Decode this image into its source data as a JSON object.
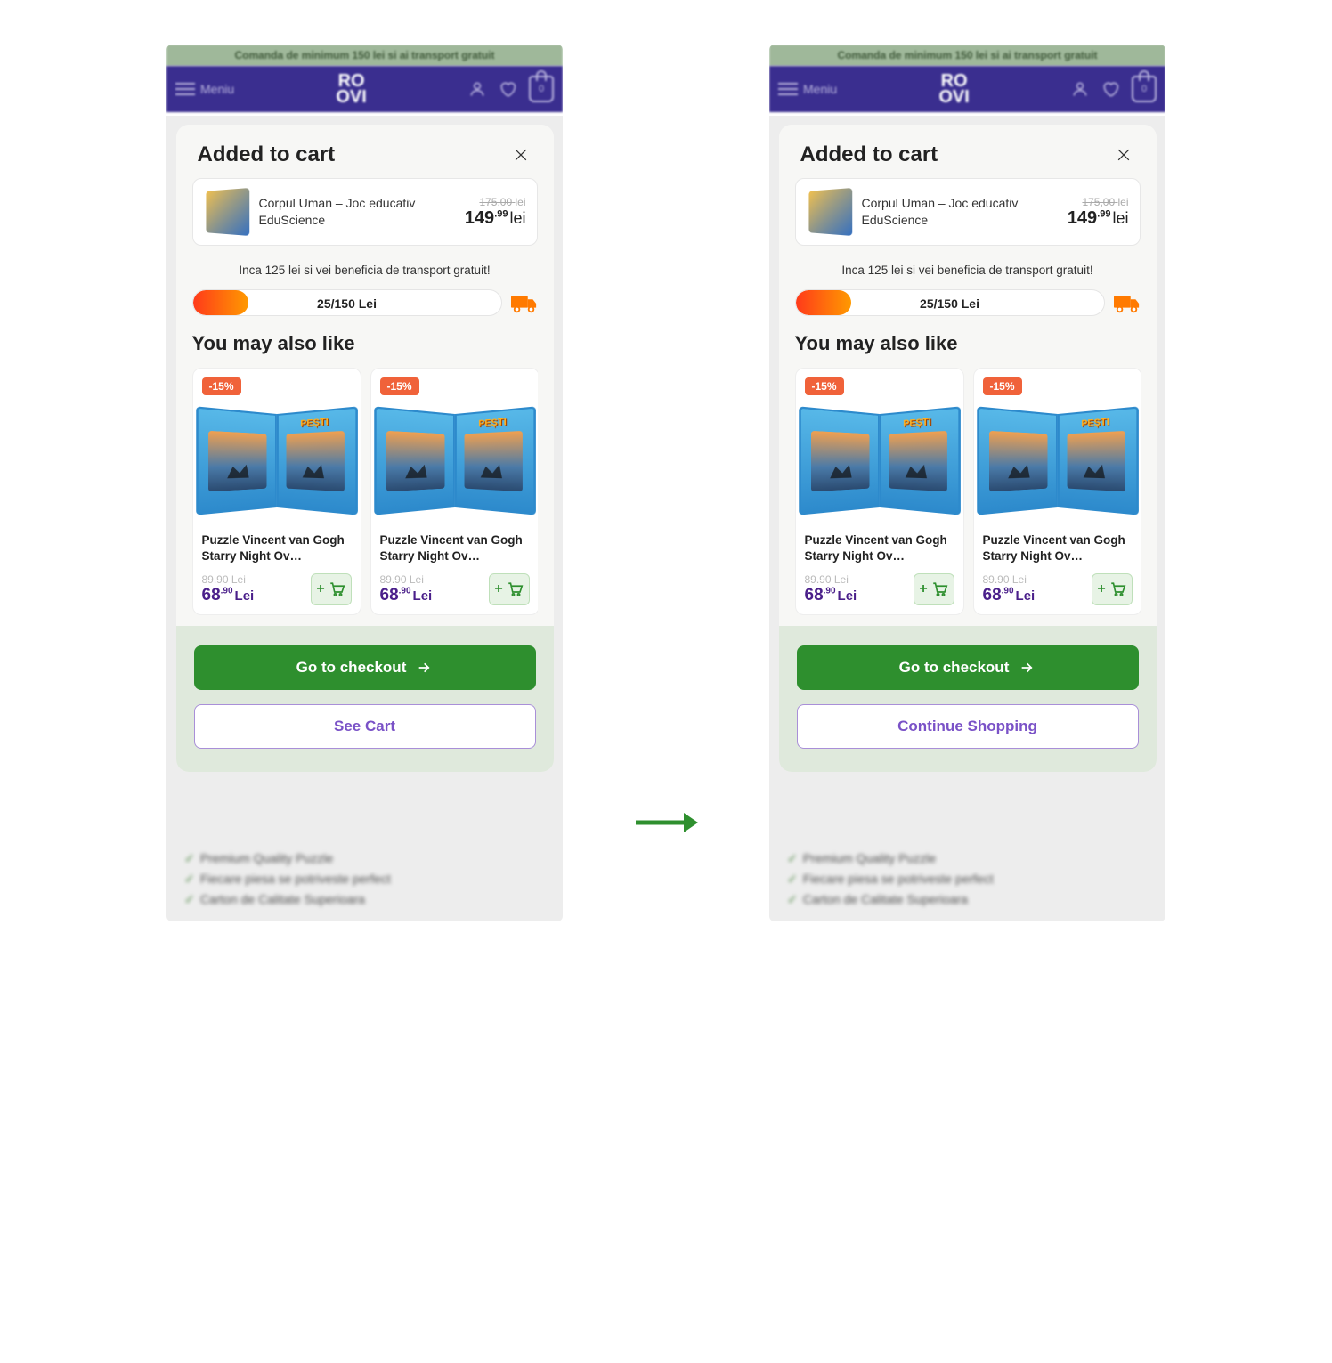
{
  "promo_bar": "Comanda de minimum 150 lei si ai transport gratuit",
  "header": {
    "menu_label": "Meniu",
    "logo_top": "RO",
    "logo_bot": "OVI",
    "bag_count": "0"
  },
  "bg_features": [
    "Premium Quality Puzzle",
    "Fiecare piesa se potriveste perfect",
    "Carton de Calitate Superioara"
  ],
  "modal": {
    "title": "Added to cart",
    "product": {
      "name": "Corpul Uman – Joc educativ EduScience",
      "old_price": "175,00",
      "old_currency": "lei",
      "price_int": "149",
      "price_dec": ".99",
      "currency": "lei"
    },
    "shipping_text": "Inca 125 lei si vei beneficia de transport gratuit!",
    "progress_label": "25/150 Lei",
    "yml_title": "You may also like",
    "yml_items": [
      {
        "discount": "-15%",
        "name": "Puzzle Vincent van Gogh Starry Night Ov…",
        "old_price": "89.90 Lei",
        "price_int": "68",
        "price_dec": ".90",
        "currency": "Lei",
        "book_label": "PEȘTI"
      },
      {
        "discount": "-15%",
        "name": "Puzzle Vincent van Gogh Starry Night Ov…",
        "old_price": "89.90 Lei",
        "price_int": "68",
        "price_dec": ".90",
        "currency": "Lei",
        "book_label": "PEȘTI"
      }
    ],
    "checkout_label": "Go to checkout"
  },
  "secondary_label_a": "See Cart",
  "secondary_label_b": "Continue Shopping"
}
